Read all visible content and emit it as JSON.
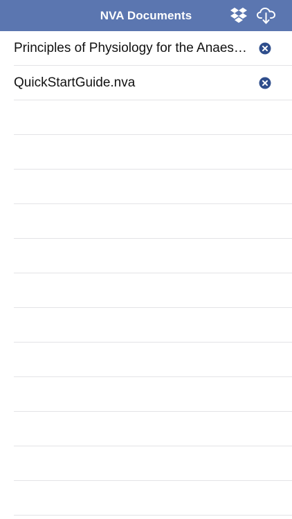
{
  "navbar": {
    "title": "NVA Documents",
    "background": "#5b76b0",
    "right_icons": [
      "dropbox-icon",
      "cloud-download-icon"
    ]
  },
  "documents": [
    {
      "name": "Principles of Physiology for the Anaesthetist.nva",
      "action_icon": "remove-icon"
    },
    {
      "name": "QuickStartGuide.nva",
      "action_icon": "remove-icon"
    }
  ],
  "accent_color": "#2f4e8c"
}
